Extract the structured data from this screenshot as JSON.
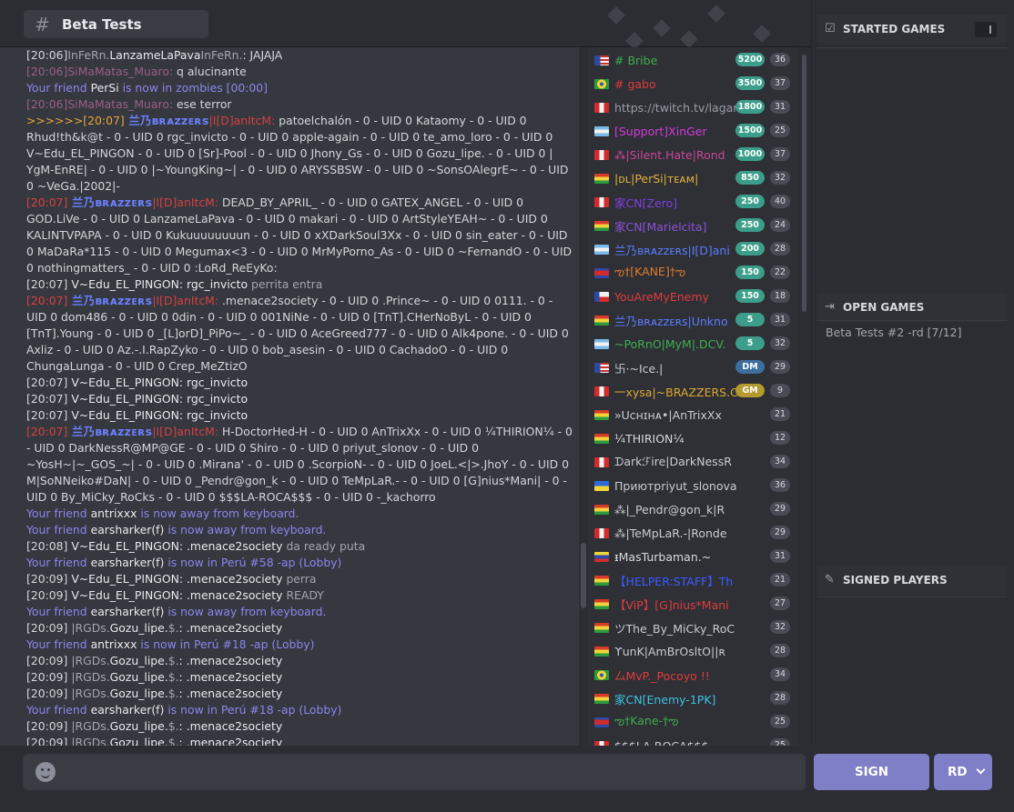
{
  "header": {
    "channel_name": "Beta Tests"
  },
  "chat": [
    {
      "ts": "[20:06]",
      "parts": [
        [
          "InFeRn.",
          "sm"
        ],
        [
          "LanzameLaPava",
          "nm"
        ],
        [
          "InFeRn.",
          "sm"
        ],
        [
          ": JAJAJA",
          "t"
        ]
      ]
    },
    {
      "ts": "[20:06]",
      "tscls": "dim",
      "parts": [
        [
          "SiMaMatas_Muaro:",
          "dim"
        ],
        [
          " q alucinante",
          "t"
        ]
      ]
    },
    {
      "ts": "",
      "parts": [
        [
          "Your friend ",
          "fr"
        ],
        [
          "PerSi",
          "nm"
        ],
        [
          " is now in zombies [00:00]",
          "fr"
        ]
      ]
    },
    {
      "ts": "[20:06]",
      "tscls": "dim",
      "parts": [
        [
          "SiMaMatas_Muaro:",
          "dim"
        ],
        [
          " ese terror",
          "t"
        ]
      ]
    },
    {
      "ts": ">>>>>>[20:07]",
      "tscls": "ora",
      "parts": [
        [
          " 兰乃ʙʀᴀᴢᴢᴇʀs",
          "brz"
        ],
        [
          "|I[D]anItcM:",
          "red"
        ],
        [
          " patoelchalón - 0 - UID 0 Kataomy - 0 - UID 0 Rhud!th&k@t - 0 - UID 0 rgc_invicto - 0 - UID 0 apple-again - 0 - UID 0 te_amo_loro - 0 - UID 0 V~Edu_EL_PINGON - 0 - UID 0 [Sr]-Pool - 0 - UID 0 Jhony_Gs - 0 - UID 0 Gozu_lipe. - 0 - UID 0 | YgM-EnRE| - 0 - UID 0 |~YoungKing~| - 0 - UID 0 ARYSSBSW - 0 - UID 0 ~SonsOAlegrE~ - 0 - UID 0 ~VeGa.|2002|-",
          "t"
        ]
      ]
    },
    {
      "ts": "[20:07]",
      "tscls": "red",
      "parts": [
        [
          " 兰乃ʙʀᴀᴢᴢᴇʀs",
          "brz"
        ],
        [
          "|I[D]anItcM:",
          "red"
        ],
        [
          " DEAD_BY_APRIL_ - 0 - UID 0 GATEX_ANGEL - 0 - UID 0 GOD.LiVe - 0 - UID 0 LanzameLaPava - 0 - UID 0 makari - 0 - UID 0 ArtStyleYEAH~ - 0 - UID 0 KALINTVPAPA - 0 - UID 0 Kukuuuuuuuun - 0 - UID 0 xXDarkSoul3Xx - 0 - UID 0 sin_eater - 0 - UID 0 MaDaRa*115 - 0 - UID 0 Megumax<3 - 0 - UID 0 MrMyPorno_As - 0 - UID 0 ~FernandO - 0 - UID 0 nothingmatters_ - 0 - UID 0 :LoRd_ReEyKo:",
          "t"
        ]
      ]
    },
    {
      "ts": "[20:07]",
      "parts": [
        [
          " V~Edu_EL_PINGON: rgc_invicto",
          "nm"
        ],
        [
          " perrita entra",
          "sm"
        ]
      ]
    },
    {
      "ts": "[20:07]",
      "tscls": "red",
      "parts": [
        [
          " 兰乃ʙʀᴀᴢᴢᴇʀs",
          "brz"
        ],
        [
          "|I[D]anItcM:",
          "red"
        ],
        [
          " .menace2society - 0 - UID 0 .Prince~ - 0 - UID 0 0111. - 0 - UID 0 dom486 - 0 - UID 0 0din - 0 - UID 0 001NiNe - 0 - UID 0 [TnT].CHerNoByL - 0 - UID 0 [TnT].Young - 0 - UID 0 _[L]orD]_PiPo~_ - 0 - UID 0 AceGreed777 - 0 - UID 0 Alk4pone. - 0 - UID 0 Axliz - 0 - UID 0 Az.-.I.RapZyko - 0 - UID 0 bob_asesin - 0 - UID 0 CachadoO - 0 - UID 0 ChungaLunga - 0 - UID 0 Crep_MeZtizO",
          "t"
        ]
      ]
    },
    {
      "ts": "[20:07]",
      "parts": [
        [
          " V~Edu_EL_PINGON: rgc_invicto",
          "nm"
        ]
      ]
    },
    {
      "ts": "[20:07]",
      "parts": [
        [
          " V~Edu_EL_PINGON: rgc_invicto",
          "nm"
        ]
      ]
    },
    {
      "ts": "[20:07]",
      "parts": [
        [
          " V~Edu_EL_PINGON: rgc_invicto",
          "nm"
        ]
      ]
    },
    {
      "ts": "[20:07]",
      "tscls": "red",
      "parts": [
        [
          " 兰乃ʙʀᴀᴢᴢᴇʀs",
          "brz"
        ],
        [
          "|I[D]anItcM:",
          "red"
        ],
        [
          " H-DoctorHed-H - 0 - UID 0 AnTrixXx - 0 - UID 0 ¼THIRION¼ - 0 - UID 0 DarkNessR@MP@GE - 0 - UID 0 Shiro - 0 - UID 0 priyut_slonov - 0 - UID 0 ~YosH~|~_GOS_~| - 0 - UID 0 .Mirana' - 0 - UID 0 .ScorpioN- - 0 - UID 0 JoeL.<|>.JhoY - 0 - UID 0 M|SoNNeiko#DaN| - 0 - UID 0 _Pendr@gon_k - 0 - UID 0 TeMpLaR.- - 0 - UID 0 [G]nius*Mani| - 0 - UID 0 By_MiCky_RoCks - 0 - UID 0 $$$LA-ROCA$$$ - 0 - UID 0 -_kachorro",
          "t"
        ]
      ]
    },
    {
      "ts": "",
      "parts": [
        [
          "Your friend ",
          "fr"
        ],
        [
          "antrixxx",
          "nm"
        ],
        [
          " is now away from keyboard.",
          "fr"
        ]
      ]
    },
    {
      "ts": "",
      "parts": [
        [
          "Your friend ",
          "fr"
        ],
        [
          "earsharker(f)",
          "nm"
        ],
        [
          " is now away from keyboard.",
          "fr"
        ]
      ]
    },
    {
      "ts": "[20:08]",
      "parts": [
        [
          " V~Edu_EL_PINGON: .menace2society",
          "nm"
        ],
        [
          " da ready puta",
          "sm"
        ]
      ]
    },
    {
      "ts": "",
      "parts": [
        [
          "Your friend ",
          "fr"
        ],
        [
          "earsharker(f)",
          "nm"
        ],
        [
          " is now in Perú  #58 -ap (Lobby)",
          "fr"
        ]
      ]
    },
    {
      "ts": "[20:09]",
      "parts": [
        [
          " V~Edu_EL_PINGON: .menace2society",
          "nm"
        ],
        [
          " perra",
          "sm"
        ]
      ]
    },
    {
      "ts": "[20:09]",
      "parts": [
        [
          " V~Edu_EL_PINGON: .menace2society",
          "nm"
        ],
        [
          " READY",
          "sm"
        ]
      ]
    },
    {
      "ts": "",
      "parts": [
        [
          "Your friend ",
          "fr"
        ],
        [
          "earsharker(f)",
          "nm"
        ],
        [
          " is now away from keyboard.",
          "fr"
        ]
      ]
    },
    {
      "ts": "[20:09]",
      "parts": [
        [
          " |RGDs.",
          "sm"
        ],
        [
          "Gozu_lipe.",
          "nm"
        ],
        [
          "$.",
          "sm"
        ],
        [
          ": .menace2society",
          "nm"
        ]
      ]
    },
    {
      "ts": "",
      "parts": [
        [
          "Your friend ",
          "fr"
        ],
        [
          "antrixxx",
          "nm"
        ],
        [
          " is now in Perú  #18 -ap (Lobby)",
          "fr"
        ]
      ]
    },
    {
      "ts": "[20:09]",
      "parts": [
        [
          " |RGDs.",
          "sm"
        ],
        [
          "Gozu_lipe.",
          "nm"
        ],
        [
          "$.",
          "sm"
        ],
        [
          ": .menace2society",
          "nm"
        ]
      ]
    },
    {
      "ts": "[20:09]",
      "parts": [
        [
          " |RGDs.",
          "sm"
        ],
        [
          "Gozu_lipe.",
          "nm"
        ],
        [
          "$.",
          "sm"
        ],
        [
          ": .menace2society",
          "nm"
        ]
      ]
    },
    {
      "ts": "[20:09]",
      "parts": [
        [
          " |RGDs.",
          "sm"
        ],
        [
          "Gozu_lipe.",
          "nm"
        ],
        [
          "$.",
          "sm"
        ],
        [
          ": .menace2society",
          "nm"
        ]
      ]
    },
    {
      "ts": "",
      "parts": [
        [
          "Your friend ",
          "fr"
        ],
        [
          "earsharker(f)",
          "nm"
        ],
        [
          " is now in Perú  #18 -ap (Lobby)",
          "fr"
        ]
      ]
    },
    {
      "ts": "[20:09]",
      "parts": [
        [
          " |RGDs.",
          "sm"
        ],
        [
          "Gozu_lipe.",
          "nm"
        ],
        [
          "$.",
          "sm"
        ],
        [
          ": .menace2society",
          "nm"
        ]
      ]
    },
    {
      "ts": "[20:09]",
      "parts": [
        [
          " |RGDs.",
          "sm"
        ],
        [
          "Gozu_lipe.",
          "nm"
        ],
        [
          "$.",
          "sm"
        ],
        [
          ": .menace2society",
          "nm"
        ]
      ]
    }
  ],
  "users": [
    {
      "flag": "us",
      "name": "# Bribe",
      "color": "#3fae4e",
      "rank": "5200",
      "count": "36"
    },
    {
      "flag": "br",
      "name": "# gabo",
      "color": "#e03b3b",
      "rank": "3500",
      "count": "37"
    },
    {
      "flag": "pe",
      "name": "https://twitch.tv/lagar",
      "color": "#9a9da4",
      "rank": "1800",
      "count": "31"
    },
    {
      "flag": "ar",
      "name": "[Support]XinGer",
      "color": "#d23bd8",
      "rank": "1500",
      "count": "25"
    },
    {
      "flag": "pe",
      "name": "⁂|Silent.Hate|Rond",
      "color": "#c9479a",
      "rank": "1000",
      "count": "37"
    },
    {
      "flag": "bo",
      "name": "|ᴅʟ|PerSi|ᴛᴇᴀᴍ|",
      "color": "#e2b13a",
      "rank": "850",
      "count": "32"
    },
    {
      "flag": "pe",
      "name": "家CN[Zero]",
      "color": "#7f3fe0",
      "rank": "250",
      "count": "40"
    },
    {
      "flag": "bo",
      "name": "家CN[Marielcita]",
      "color": "#8d52d8",
      "rank": "250",
      "count": "24"
    },
    {
      "flag": "ar",
      "name": "兰乃ʙʀᴀᴢᴢᴇʀs|I[D]ani",
      "color": "#5b7dff",
      "rank": "200",
      "count": "28"
    },
    {
      "flag": "kh",
      "name": "ఌ†[KANE]†ఌ",
      "color": "#e07b2a",
      "rank": "150",
      "count": "22"
    },
    {
      "flag": "cl",
      "name": "YouAreMyEnemy",
      "color": "#e03b3b",
      "rank": "150",
      "count": "18"
    },
    {
      "flag": "bo",
      "name": "兰乃ʙʀᴀᴢᴢᴇʀs|Unkno",
      "color": "#5b7dff",
      "rank": "5",
      "count": "31"
    },
    {
      "flag": "ar",
      "name": "~PoRnO|MyM|.DCV.",
      "color": "#3fae4e",
      "rank": "5",
      "count": "32"
    },
    {
      "flag": "us",
      "name": "卐·~Ice.|",
      "color": "#c9cbd0",
      "rank": "DM",
      "count": "29"
    },
    {
      "flag": "pe",
      "name": "一xysa|~BRAZZERS.C",
      "color": "#e0a830",
      "rank": "GM",
      "count": "9"
    },
    {
      "flag": "bo",
      "name": "»Uᴄʜɪʜᴀ•|AnTrixXx",
      "color": "#c9cbd0",
      "rank": "",
      "count": "21"
    },
    {
      "flag": "bo",
      "name": "¼THIRION¼",
      "color": "#d8dadd",
      "rank": "",
      "count": "12"
    },
    {
      "flag": "pe",
      "name": "ᗪarkℱire|DarkNessR",
      "color": "#c9cbd0",
      "rank": "",
      "count": "34"
    },
    {
      "flag": "ua",
      "name": "Приютpriyut_slonova",
      "color": "#c9cbd0",
      "rank": "",
      "count": "36"
    },
    {
      "flag": "bo",
      "name": "⁂|_Pendr@gon_k|R",
      "color": "#c9cbd0",
      "rank": "",
      "count": "29"
    },
    {
      "flag": "pe",
      "name": "⁂|TeMpLaR.-|Ronde",
      "color": "#c9cbd0",
      "rank": "",
      "count": "29"
    },
    {
      "flag": "ve",
      "name": "ᵻMasTurbaman.~",
      "color": "#d8dadd",
      "rank": "",
      "count": "31"
    },
    {
      "flag": "bo",
      "name": "【HELPER:STAFF】Th",
      "color": "#3b5bff",
      "rank": "",
      "count": "21"
    },
    {
      "flag": "bo",
      "name": "【ViP】[G]nius*Mani",
      "color": "#e03b3b",
      "rank": "",
      "count": "27"
    },
    {
      "flag": "bo",
      "name": "ツThe_By_MiCky_RoC",
      "color": "#c9cbd0",
      "rank": "",
      "count": "32"
    },
    {
      "flag": "bo",
      "name": "ϒunK|AmBrOsltO||ʀ",
      "color": "#c9cbd0",
      "rank": "",
      "count": "28"
    },
    {
      "flag": "br",
      "name": "厶MvP._Pocoyo !!",
      "color": "#e03b3b",
      "rank": "",
      "count": "34"
    },
    {
      "flag": "bo",
      "name": "家CN[Enemy-1PK]",
      "color": "#3fc0e0",
      "rank": "",
      "count": "28"
    },
    {
      "flag": "kh",
      "name": "ఌ†Kane-†ఌ",
      "color": "#3fae4e",
      "rank": "",
      "count": "25"
    },
    {
      "flag": "pe",
      "name": "$$$LA-ROCA$$$",
      "color": "#c9cbd0",
      "rank": "",
      "count": "25"
    }
  ],
  "right_panel": {
    "started_games_label": "STARTED GAMES",
    "open_games_label": "OPEN GAMES",
    "open_games": [
      "Beta Tests #2 -rd [7/12]"
    ],
    "signed_players_label": "SIGNED PLAYERS"
  },
  "bottom": {
    "sign_label": "SIGN",
    "mode_label": "RD"
  },
  "colors": {
    "accent": "#7e7fc6",
    "friend": "#8a86ee",
    "admin_red": "#d64141"
  }
}
